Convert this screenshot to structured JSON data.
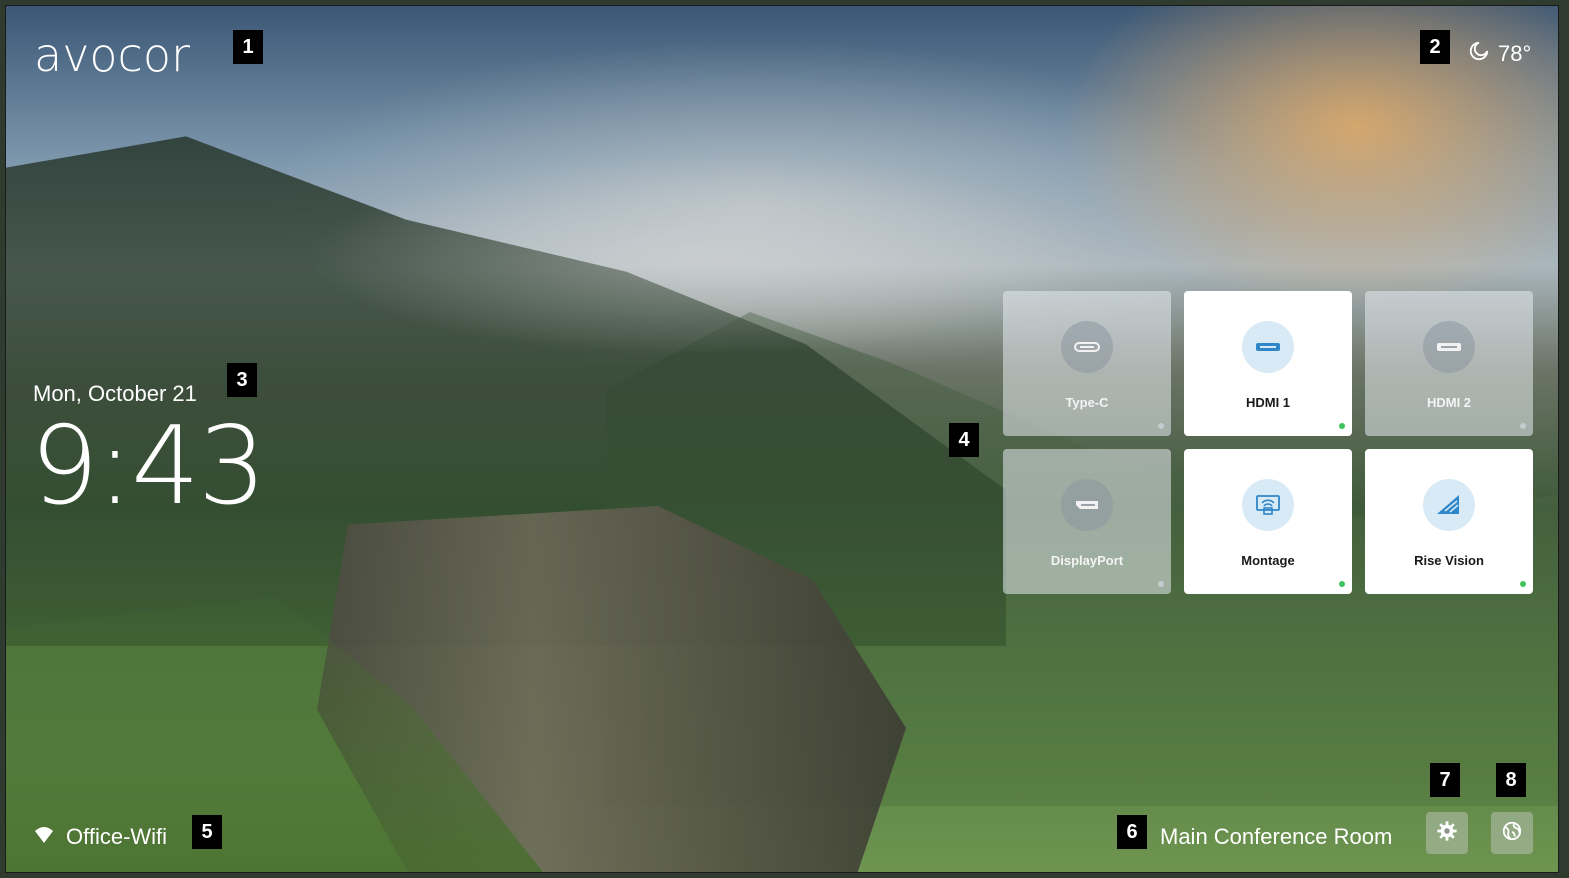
{
  "brand": {
    "logo_text": "avocor"
  },
  "weather": {
    "icon": "moon-icon",
    "temperature": "78°"
  },
  "datetime": {
    "date": "Mon, October 21",
    "time": "9:43"
  },
  "sources": [
    {
      "label": "Type-C",
      "icon": "usb-c-icon",
      "active": false
    },
    {
      "label": "HDMI 1",
      "icon": "hdmi-icon",
      "active": true
    },
    {
      "label": "HDMI 2",
      "icon": "hdmi-icon",
      "active": false
    },
    {
      "label": "DisplayPort",
      "icon": "displayport-icon",
      "active": false
    },
    {
      "label": "Montage",
      "icon": "montage-icon",
      "active": true
    },
    {
      "label": "Rise Vision",
      "icon": "rise-vision-icon",
      "active": true
    }
  ],
  "footer": {
    "wifi_icon": "wifi-icon",
    "network_name": "Office-Wifi",
    "room_name": "Main Conference Room",
    "settings_icon": "gear-icon",
    "globe_icon": "globe-icon"
  },
  "annotations": [
    "1",
    "2",
    "3",
    "4",
    "5",
    "6",
    "7",
    "8"
  ],
  "colors": {
    "active_dot": "#3fc35c",
    "active_icon_bg": "#d8eaf6",
    "icon_blue": "#2f86c9"
  }
}
